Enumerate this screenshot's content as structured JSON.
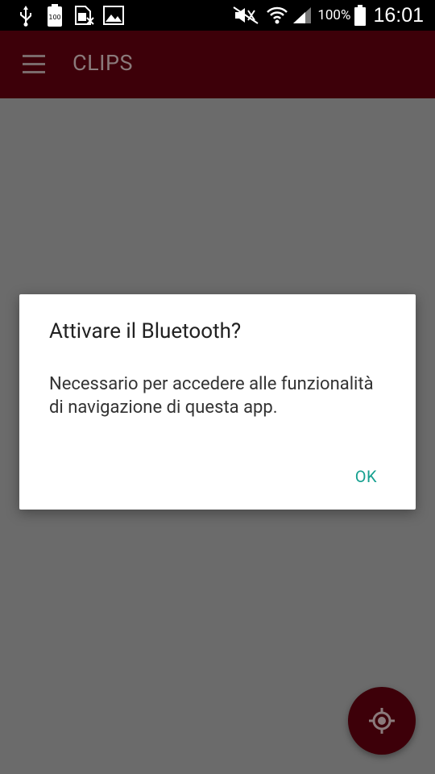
{
  "status_bar": {
    "icons_left": [
      "usb-icon",
      "battery-100-icon",
      "sim-card-icon",
      "image-icon"
    ],
    "icons_right": [
      "mute-icon",
      "wifi-icon",
      "signal-icon",
      "battery-icon"
    ],
    "battery_percent": "100%",
    "time": "16:01"
  },
  "app_bar": {
    "title": "CLIPS",
    "menu_icon": "hamburger-menu-icon",
    "color": "#3d0009"
  },
  "dialog": {
    "title": "Attivare il Bluetooth?",
    "message": "Necessario per accedere alle funzionalità di navigazione di questa app.",
    "ok_label": "OK",
    "accent": "#16a090"
  },
  "fab": {
    "icon": "my-location-icon"
  }
}
